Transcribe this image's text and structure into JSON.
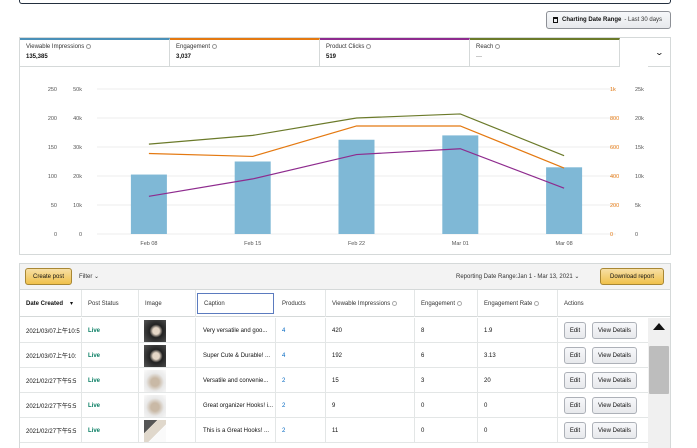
{
  "date_range": {
    "label": "Charting Date Range",
    "value": "- Last 30 days"
  },
  "metrics": [
    {
      "name": "Viewable Impressions",
      "value": "135,385",
      "color": "#4a90b8"
    },
    {
      "name": "Engagement",
      "value": "3,037",
      "color": "#e47911"
    },
    {
      "name": "Product Clicks",
      "value": "519",
      "color": "#8e2b8e"
    },
    {
      "name": "Reach",
      "value": "—",
      "color": "#6b7a2a"
    }
  ],
  "chart_data": {
    "type": "bar",
    "categories": [
      "Feb 08",
      "Feb 15",
      "Feb 22",
      "Mar 01",
      "Mar 08"
    ],
    "left_axis_outer": {
      "ticks": [
        "250",
        "200",
        "150",
        "100",
        "50",
        "0"
      ]
    },
    "left_axis_inner": {
      "ticks": [
        "50k",
        "40k",
        "30k",
        "20k",
        "10k",
        "0"
      ],
      "ylim": [
        0,
        50000
      ]
    },
    "right_axis_inner": {
      "ticks": [
        "1k",
        "800",
        "600",
        "400",
        "200",
        "0"
      ],
      "ylim": [
        0,
        1000
      ]
    },
    "right_axis_outer": {
      "ticks": [
        "25k",
        "20k",
        "15k",
        "10k",
        "5k",
        "0"
      ],
      "ylim": [
        0,
        25000
      ]
    },
    "series": [
      {
        "name": "Viewable Impressions",
        "kind": "bar",
        "axis": "left_inner",
        "color": "#7fb8d6",
        "values": [
          20500,
          25000,
          32500,
          34000,
          23000
        ]
      },
      {
        "name": "Engagement",
        "kind": "line",
        "axis": "right_inner",
        "color": "#e47911",
        "values": [
          555,
          535,
          745,
          745,
          455
        ]
      },
      {
        "name": "Product Clicks",
        "kind": "line",
        "axis": "left_outer",
        "color": "#8e2b8e",
        "values": [
          65,
          95,
          137,
          147,
          79
        ]
      },
      {
        "name": "Reach",
        "kind": "line",
        "axis": "right_outer",
        "color": "#6b7a2a",
        "values": [
          15500,
          17000,
          20000,
          20700,
          13500
        ]
      }
    ],
    "grid": true
  },
  "toolbar": {
    "create_label": "Create post",
    "filter_label": "Filter",
    "reporting_label": "Reporting Date Range:Jan 1 - Mar 13, 2021",
    "download_label": "Download report"
  },
  "columns": [
    "Date Created",
    "Post Status",
    "Image",
    "Caption",
    "Products",
    "Viewable Impressions",
    "Engagement",
    "Engagement Rate",
    "Actions"
  ],
  "rows": [
    {
      "date": "2021/03/07上午10:5",
      "status": "Live",
      "thumb": "dark",
      "caption": "Very versatile and goo...",
      "products": "4",
      "impressions": "420",
      "engagement": "8",
      "rate": "1.9",
      "edit": "Edit",
      "view": "View Details"
    },
    {
      "date": "2021/03/07上午10:",
      "status": "Live",
      "thumb": "dark",
      "caption": "Super Cute & Durable! ...",
      "products": "4",
      "impressions": "192",
      "engagement": "6",
      "rate": "3.13",
      "edit": "Edit",
      "view": "View Details"
    },
    {
      "date": "2021/02/27下午5:5",
      "status": "Live",
      "thumb": "light",
      "caption": "Versatile and convenie...",
      "products": "2",
      "impressions": "15",
      "engagement": "3",
      "rate": "20",
      "edit": "Edit",
      "view": "View Details"
    },
    {
      "date": "2021/02/27下午5:5",
      "status": "Live",
      "thumb": "light",
      "caption": "Great organizer Hooks! i...",
      "products": "2",
      "impressions": "9",
      "engagement": "0",
      "rate": "0",
      "edit": "Edit",
      "view": "View Details"
    },
    {
      "date": "2021/02/27下午5:5",
      "status": "Live",
      "thumb": "mixed",
      "caption": "This is a Great Hooks! ...",
      "products": "2",
      "impressions": "11",
      "engagement": "0",
      "rate": "0",
      "edit": "Edit",
      "view": "View Details"
    }
  ]
}
